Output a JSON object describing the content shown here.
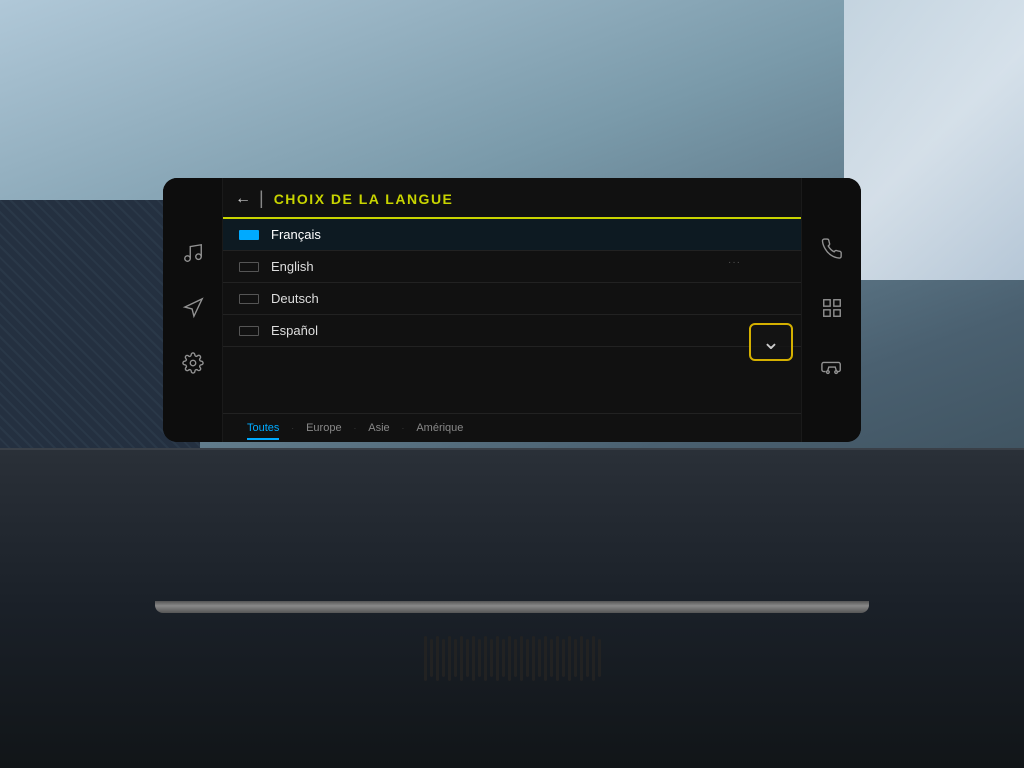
{
  "scene": {
    "title": "Car Infotainment Language Selection"
  },
  "header": {
    "back_label": "←",
    "divider": "|",
    "title": "CHOIX DE LA LANGUE"
  },
  "languages": [
    {
      "id": "fr",
      "name": "Français",
      "selected": true
    },
    {
      "id": "en",
      "name": "English",
      "selected": false
    },
    {
      "id": "de",
      "name": "Deutsch",
      "selected": false
    },
    {
      "id": "es",
      "name": "Español",
      "selected": false
    }
  ],
  "tabs": [
    {
      "id": "all",
      "label": "Toutes",
      "active": true
    },
    {
      "id": "europe",
      "label": "Europe",
      "active": false
    },
    {
      "id": "asie",
      "label": "Asie",
      "active": false
    },
    {
      "id": "amerique",
      "label": "Amérique",
      "active": false
    }
  ],
  "left_icons": [
    {
      "id": "music",
      "symbol": "♪"
    },
    {
      "id": "nav",
      "symbol": "⊳"
    },
    {
      "id": "settings",
      "symbol": "⚙"
    }
  ],
  "right_icons": [
    {
      "id": "phone",
      "symbol": "✆"
    },
    {
      "id": "apps",
      "symbol": "⊞"
    },
    {
      "id": "car",
      "symbol": "⬡"
    }
  ],
  "colors": {
    "accent_yellow": "#c8d400",
    "accent_blue": "#00aaff",
    "highlight_border": "#d4b000",
    "text_primary": "#dddddd",
    "text_dim": "#888888",
    "bg_screen": "#111111"
  }
}
